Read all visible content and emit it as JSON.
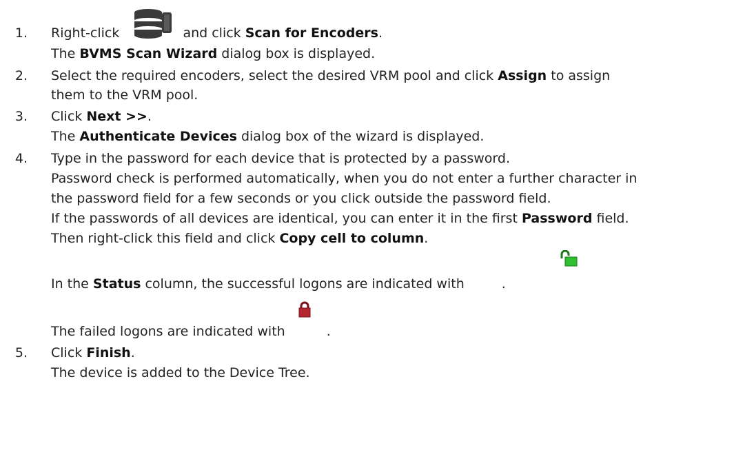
{
  "steps": [
    {
      "number": "1.",
      "lines": [
        {
          "t1": "Right-click",
          "t2": "and click",
          "b1": "Scan for Encoders",
          "t3": "."
        },
        {
          "t1": "The",
          "b1": "BVMS Scan Wizard",
          "t2": "dialog box is displayed."
        }
      ]
    },
    {
      "number": "2.",
      "lines": [
        {
          "t1": "Select the required encoders, select the desired VRM pool and click",
          "b1": "Assign",
          "t2": "to assign"
        },
        {
          "t1": "them to the VRM pool."
        }
      ]
    },
    {
      "number": "3.",
      "lines": [
        {
          "t1": "Click",
          "b1": "Next >>",
          "t2": "."
        },
        {
          "t1": "The",
          "b1": "Authenticate Devices",
          "t2": "dialog box of the wizard is displayed."
        }
      ]
    },
    {
      "number": "4.",
      "lines": [
        {
          "t1": "Type in the password for each device that is protected by a password."
        },
        {
          "t1": "Password check is performed automatically, when you do not enter a further character in"
        },
        {
          "t1": "the password field for a few seconds or you click outside the password field."
        },
        {
          "t1": "If the passwords of all devices are identical, you can enter it in the first",
          "b1": "Password",
          "t2": "field."
        },
        {
          "t1": "Then right-click this field and click",
          "b1": "Copy cell to column",
          "t2": "."
        },
        {
          "t1": "In the",
          "b1": "Status",
          "t2": "column, the successful logons are indicated with",
          "t3": "."
        },
        {
          "t1": "The failed logons are indicated with",
          "t2": "."
        }
      ]
    },
    {
      "number": "5.",
      "lines": [
        {
          "t1": "Click",
          "b1": "Finish",
          "t2": "."
        },
        {
          "t1": "The device is added to the Device Tree."
        }
      ]
    }
  ],
  "icons": {
    "server": "server-stack-icon",
    "unlocked": "unlocked-padlock-icon",
    "locked": "locked-padlock-icon",
    "colors": {
      "server": "#3a3a3a",
      "unlocked": "#2fbf2f",
      "locked": "#b3262e"
    }
  }
}
